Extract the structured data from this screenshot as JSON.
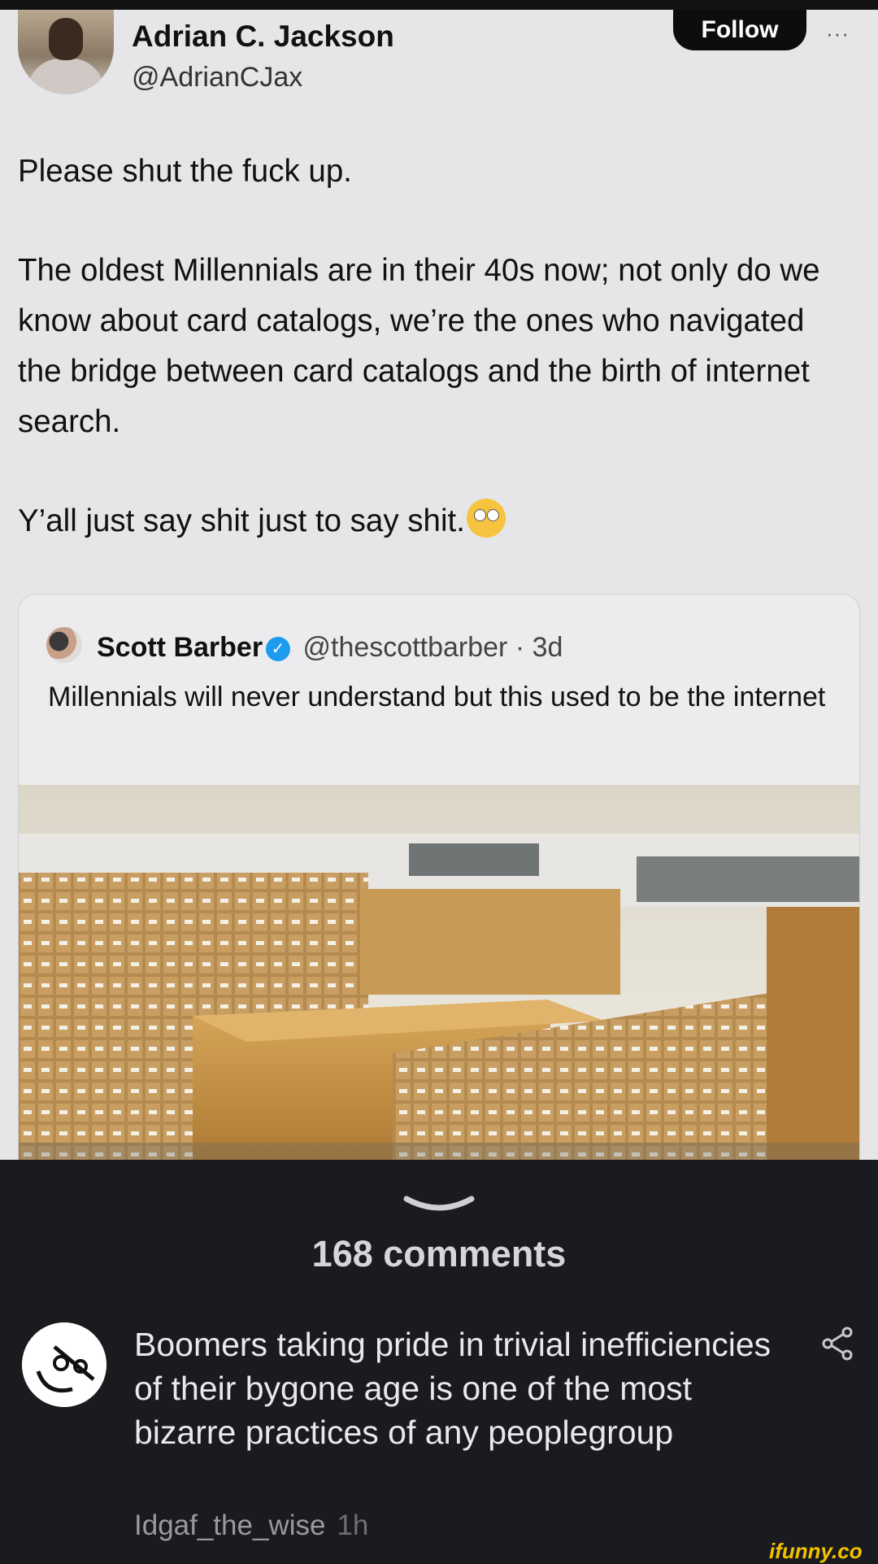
{
  "tweet": {
    "author_name": "Adrian C. Jackson",
    "author_handle": "@AdrianCJax",
    "follow_label": "Follow",
    "more_label": "···",
    "paragraphs": [
      "Please shut the fuck up.",
      "The oldest Millennials are in their 40s now; not only do we know about card catalogs, we’re the ones who navigated the bridge between card catalogs and the birth of internet search.",
      "Y’all just say shit just to say shit."
    ],
    "emoji": "eye-roll-emoji"
  },
  "quote": {
    "author_name": "Scott Barber",
    "author_handle": "@thescottbarber",
    "separator": "·",
    "age": "3d",
    "text": "Millennials will never understand but this used to be the internet"
  },
  "comments_sheet": {
    "count_label": "168 comments",
    "comment": {
      "text": "Boomers taking pride in trivial inefficiencies of their bygone age is one of the most bizarre practices of any peoplegroup",
      "username": "Idgaf_the_wise",
      "time": "1h"
    },
    "watermark": "ifunny.co"
  },
  "colors": {
    "tweet_bg": "#e6e6e8",
    "sheet_bg": "#1a1b1f",
    "verified": "#1d9bf0",
    "watermark": "#f2c200"
  }
}
